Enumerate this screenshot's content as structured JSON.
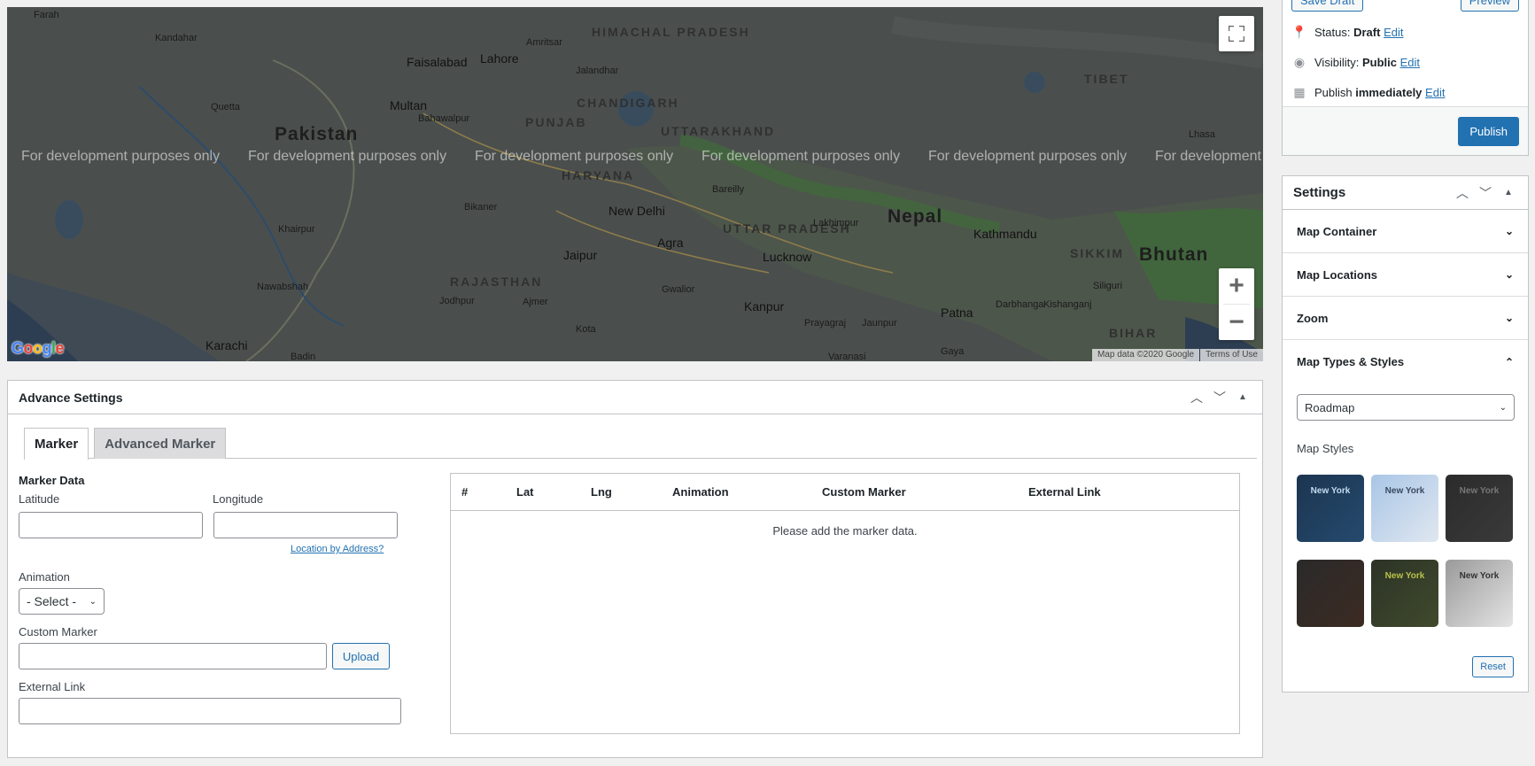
{
  "map": {
    "watermark": "For development purposes only",
    "attribution": "Map data ©2020 Google",
    "terms": "Terms of Use",
    "logo": "Google",
    "countries": [
      "Pakistan",
      "Nepal",
      "Bhutan"
    ],
    "states": [
      "HIMACHAL PRADESH",
      "CHANDIGARH",
      "PUNJAB",
      "UTTARAKHAND",
      "HARYANA",
      "UTTAR PRADESH",
      "RAJASTHAN",
      "SIKKIM",
      "BIHAR",
      "TIBET"
    ],
    "cities": [
      "Lahore",
      "Faisalabad",
      "Multan",
      "Kandahar",
      "Quetta",
      "New Delhi",
      "Agra",
      "Jaipur",
      "Lucknow",
      "Kanpur",
      "Kathmandu",
      "Patna",
      "Karachi"
    ],
    "small_places": [
      "Farah",
      "Amritsar",
      "Jalandhar",
      "Bahawalpur",
      "Bikaner",
      "Bareilly",
      "Lakhimpur",
      "Khairpur",
      "Nawabshah",
      "Jodhpur",
      "Ajmer",
      "Gwalior",
      "Kota",
      "Prayagraj",
      "Jaunpur",
      "Varanasi",
      "Darbhanga",
      "Kishanganj",
      "Siliguri",
      "Gaya",
      "Lhasa",
      "Badin"
    ]
  },
  "advance": {
    "title": "Advance Settings",
    "tabs": [
      "Marker",
      "Advanced Marker"
    ],
    "marker_data_label": "Marker Data",
    "latitude_label": "Latitude",
    "longitude_label": "Longitude",
    "location_link": "Location by Address?",
    "animation_label": "Animation",
    "animation_value": "- Select -",
    "custom_marker_label": "Custom Marker",
    "upload_label": "Upload",
    "external_link_label": "External Link",
    "table": {
      "columns": [
        "#",
        "Lat",
        "Lng",
        "Animation",
        "Custom Marker",
        "External Link"
      ],
      "empty": "Please add the marker data."
    }
  },
  "publish": {
    "save_draft": "Save Draft",
    "preview": "Preview",
    "status_label": "Status:",
    "status_value": "Draft",
    "visibility_label": "Visibility:",
    "visibility_value": "Public",
    "publish_label": "Publish",
    "publish_value": "immediately",
    "edit": "Edit",
    "publish_button": "Publish"
  },
  "settings": {
    "title": "Settings",
    "sections": [
      "Map Container",
      "Map Locations",
      "Zoom",
      "Map Types & Styles"
    ],
    "map_type": "Roadmap",
    "styles_label": "Map Styles",
    "thumb_text": "New York",
    "reset": "Reset"
  },
  "colors": {
    "accent": "#2271b1",
    "map_bg": "#474c4b"
  }
}
